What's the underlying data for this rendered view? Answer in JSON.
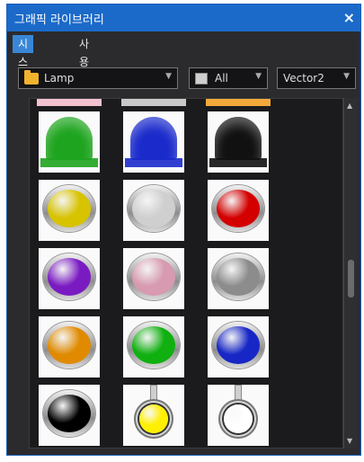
{
  "window": {
    "title": "그래픽 라이브러리",
    "close_glyph": "×"
  },
  "tabs": [
    {
      "label": "시스템",
      "active": true
    },
    {
      "label": "사용자",
      "active": false
    }
  ],
  "toolbar": {
    "category": {
      "value": "Lamp",
      "icon": "folder-icon"
    },
    "filter": {
      "value": "All",
      "icon": "color-swatch-icon"
    },
    "style": {
      "value": "Vector2"
    }
  },
  "colors": {
    "accent": "#1b6ac9",
    "strips": [
      "#f2c1cf",
      "#c8c8c8",
      "#f2a93a"
    ],
    "rect_domes": [
      "#1ea41e",
      "#1a2acb",
      "#111111"
    ],
    "lamps": [
      "#d7c300",
      "#cfcfcf",
      "#d40000",
      "#7a1bc2",
      "#d79ab0",
      "#8c8c8c",
      "#e08a00",
      "#10b010",
      "#1727c6",
      "#000000",
      "#ffef00",
      "#ffffff"
    ]
  },
  "library_items": [
    "lamp-green-rect",
    "lamp-blue-rect",
    "lamp-black-rect",
    "lamp-yellow",
    "lamp-silver",
    "lamp-red",
    "lamp-purple",
    "lamp-pink",
    "lamp-gray",
    "lamp-orange",
    "lamp-green",
    "lamp-blue",
    "lamp-black",
    "lamp-yellow-stem",
    "lamp-white-stem"
  ]
}
